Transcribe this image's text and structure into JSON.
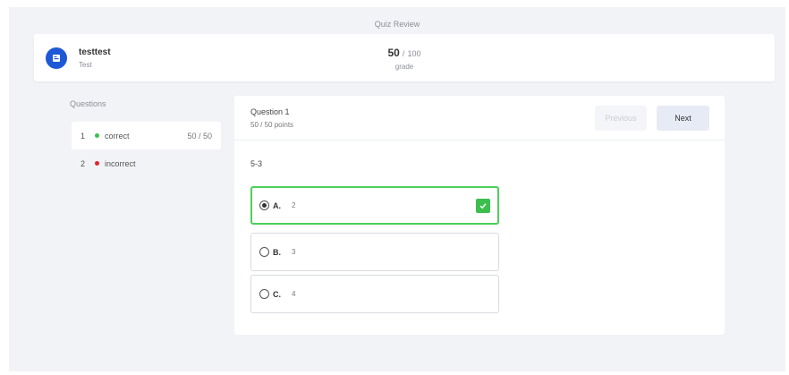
{
  "page": {
    "title": "Quiz Review"
  },
  "header": {
    "user_name": "testtest",
    "user_role": "Test",
    "grade_score": "50",
    "grade_separator": "/",
    "grade_total": "100",
    "grade_label": "grade"
  },
  "sidebar": {
    "heading": "Questions",
    "items": [
      {
        "number": "1",
        "status": "correct",
        "score": "50 / 50",
        "dot_color": "#3cc24f"
      },
      {
        "number": "2",
        "status": "incorrect",
        "score": "",
        "dot_color": "#e0242f"
      }
    ]
  },
  "question": {
    "title": "Question 1",
    "points": "50 / 50 points",
    "previous_label": "Previous",
    "next_label": "Next",
    "prompt": "5-3",
    "options": [
      {
        "letter": "A.",
        "text": "2",
        "selected": true,
        "correct": true
      },
      {
        "letter": "B.",
        "text": "3",
        "selected": false,
        "correct": false
      },
      {
        "letter": "C.",
        "text": "4",
        "selected": false,
        "correct": false
      }
    ]
  },
  "colors": {
    "accent": "#1f58d6",
    "correct": "#3cbf4f",
    "incorrect": "#e0242f"
  }
}
